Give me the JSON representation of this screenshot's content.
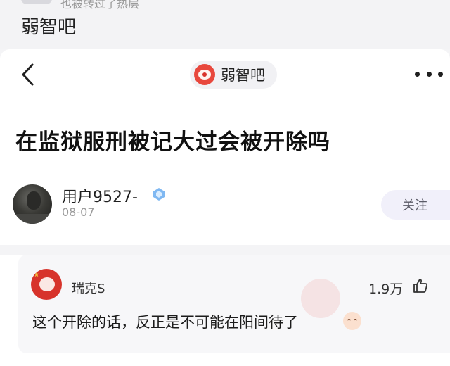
{
  "top": {
    "cut_text": "也被转过了热层",
    "forum_heading": "弱智吧"
  },
  "nav": {
    "forum_name": "弱智吧",
    "back_icon": "chevron-left-icon",
    "more_icon": "more-dots-icon"
  },
  "post": {
    "title": "在监狱服刑被记大过会被开除吗",
    "author": {
      "name": "用户9527-",
      "date": "08-07",
      "badge_icon": "diamond-badge-icon",
      "avatar_label": "author avatar"
    },
    "follow_label": "关注"
  },
  "comment": {
    "user": "瑞克S",
    "likes": "1.9万",
    "text": "这个开除的话，反正是不可能在阳间待了",
    "emoji_icon": "smiling-face-icon",
    "like_icon": "thumbs-up-icon"
  },
  "colors": {
    "background": "#f4f4f6",
    "card": "#ffffff",
    "follow_bg": "#f1f0fa",
    "badge": "#6fb0f0"
  }
}
